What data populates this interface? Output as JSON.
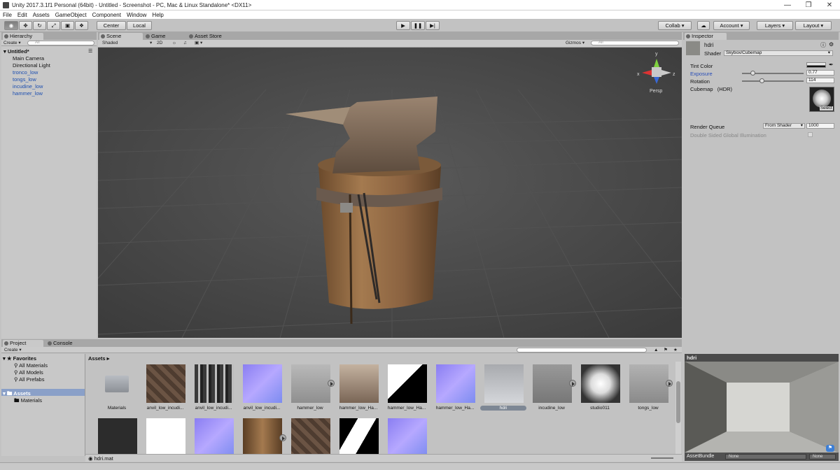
{
  "window": {
    "title": "Unity 2017.3.1f1 Personal (64bit) - Untitled - Screenshot - PC, Mac & Linux Standalone* <DX11>"
  },
  "menu": [
    "File",
    "Edit",
    "Assets",
    "GameObject",
    "Component",
    "Window",
    "Help"
  ],
  "toolbar": {
    "pivot": "Center",
    "space": "Local",
    "collab": "Collab ▾",
    "account": "Account",
    "layers": "Layers",
    "layout": "Layout"
  },
  "hierarchy": {
    "tab": "Hierarchy",
    "create": "Create",
    "search_placeholder": "All",
    "scene": "Untitled*",
    "items": [
      {
        "label": "Main Camera",
        "blue": false
      },
      {
        "label": "Directional Light",
        "blue": false
      },
      {
        "label": "tronco_low",
        "blue": true
      },
      {
        "label": "tongs_low",
        "blue": true
      },
      {
        "label": "incudine_low",
        "blue": true
      },
      {
        "label": "hammer_low",
        "blue": true
      }
    ]
  },
  "scene": {
    "tabs": [
      "Scene",
      "Game",
      "Asset Store"
    ],
    "shading": "Shaded",
    "mode2d": "2D",
    "gizmos": "Gizmos",
    "search_placeholder": "All",
    "persp": "Persp",
    "axis_x": "x",
    "axis_y": "y",
    "axis_z": "z"
  },
  "inspector": {
    "tab": "Inspector",
    "name": "hdri",
    "shader_label": "Shader",
    "shader_value": "Skybox/Cubemap",
    "tint_label": "Tint Color",
    "exposure_label": "Exposure",
    "exposure_value": "0.77",
    "exposure_level": 0.17,
    "rotation_label": "Rotation",
    "rotation_value": "114",
    "rotation_level": 0.32,
    "cubemap_label": "Cubemap",
    "cubemap_hdr": "(HDR)",
    "select": "Select",
    "render_queue_label": "Render Queue",
    "render_queue_mode": "From Shader",
    "render_queue_value": "1000",
    "double_sided": "Double Sided Global Illumination"
  },
  "project": {
    "tabs": [
      "Project",
      "Console"
    ],
    "create": "Create",
    "favorites": "Favorites",
    "fav_items": [
      "All Materials",
      "All Models",
      "All Prefabs"
    ],
    "assets_root": "Assets",
    "assets_children": [
      "Materials"
    ],
    "breadcrumb": "Assets ▸",
    "status_file": "hdri.mat",
    "row1": [
      {
        "label": "Materials",
        "kind": "folder"
      },
      {
        "label": "anvil_low_incudi...",
        "kind": "rust"
      },
      {
        "label": "anvil_low_incudi...",
        "kind": "grey"
      },
      {
        "label": "anvil_low_incudi...",
        "kind": "normal"
      },
      {
        "label": "hammer_low",
        "kind": "hammer"
      },
      {
        "label": "hammer_low_Ha...",
        "kind": "hammerrust"
      },
      {
        "label": "hammer_low_Ha...",
        "kind": "bw"
      },
      {
        "label": "hammer_low_Ha...",
        "kind": "normal"
      },
      {
        "label": "hdri",
        "kind": "hdri",
        "selected": true
      },
      {
        "label": "incudine_low",
        "kind": "anvil"
      },
      {
        "label": "studio011",
        "kind": "sphere"
      },
      {
        "label": "tongs_low",
        "kind": "tongs"
      }
    ],
    "row2": [
      "dark",
      "white",
      "normal",
      "stump",
      "rust",
      "bwmask",
      "normal"
    ]
  },
  "preview": {
    "title": "hdri",
    "bundle_label": "AssetBundle",
    "bundle_value": "None",
    "variant_value": "None"
  }
}
